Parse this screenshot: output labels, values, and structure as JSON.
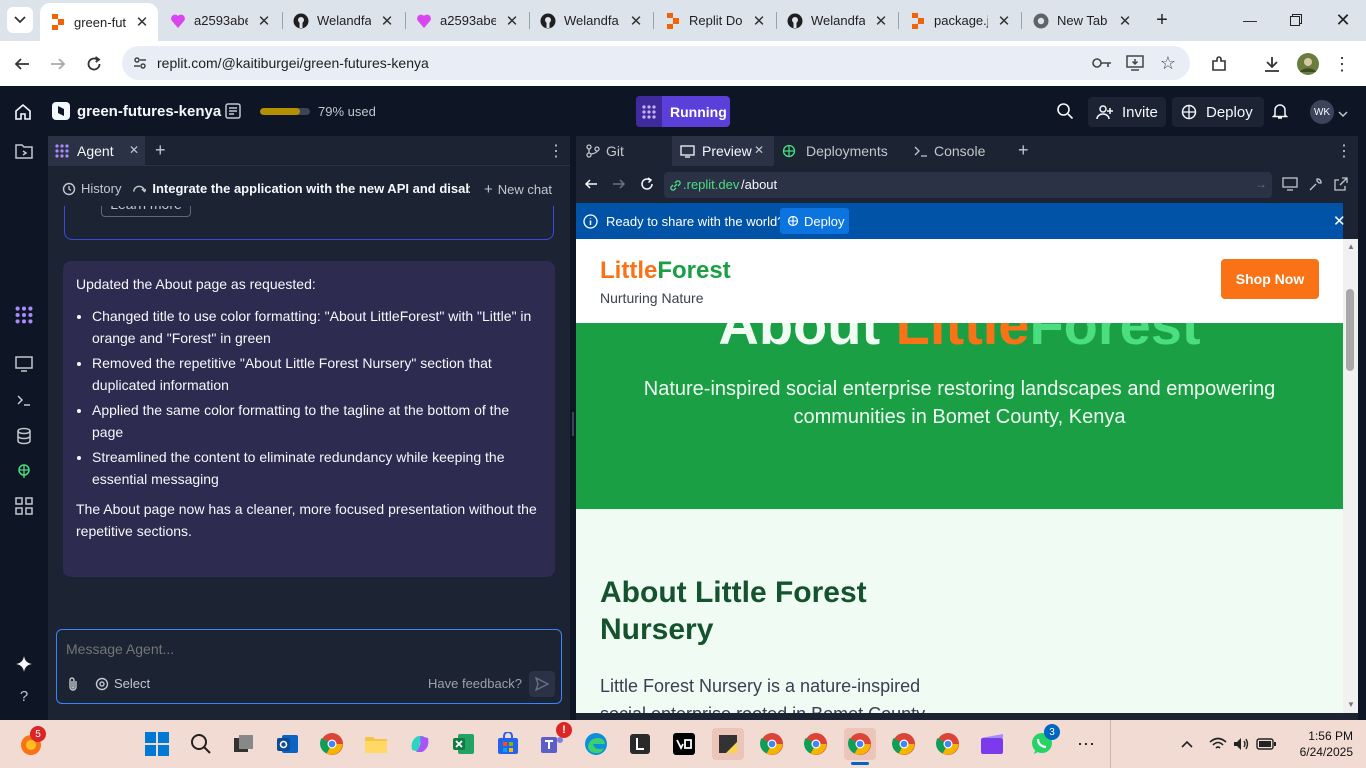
{
  "browser": {
    "tabs": [
      {
        "title": "green-futures-kenya",
        "favicon": "replit-icon",
        "active": true
      },
      {
        "title": "a2593abe",
        "favicon": "lovable-icon"
      },
      {
        "title": "Welandfa",
        "favicon": "github-icon"
      },
      {
        "title": "a2593abe",
        "favicon": "lovable-icon"
      },
      {
        "title": "Welandfa",
        "favicon": "github-icon"
      },
      {
        "title": "Replit Do",
        "favicon": "replit-icon"
      },
      {
        "title": "Welandfa",
        "favicon": "github-icon"
      },
      {
        "title": "package.js",
        "favicon": "replit-icon"
      },
      {
        "title": "New Tab",
        "favicon": "chrome-icon"
      }
    ],
    "url": "replit.com/@kaitiburgei/green-futures-kenya"
  },
  "header": {
    "project_name": "green-futures-kenya",
    "usage_text": "79% used",
    "usage_fraction": 0.79,
    "run_status": "Running",
    "invite_label": "Invite",
    "deploy_label": "Deploy",
    "avatar_initials": "WK"
  },
  "agent": {
    "tab_label": "Agent",
    "history_label": "History",
    "thread_title": "Integrate the application with the new API and disable S...",
    "new_chat_label": "New chat",
    "learn_more": "Learn more",
    "message": {
      "intro": "Updated the About page as requested:",
      "bullets": [
        "Changed title to use color formatting: \"About LittleForest\" with \"Little\" in orange and \"Forest\" in green",
        "Removed the repetitive \"About Little Forest Nursery\" section that duplicated information",
        "Applied the same color formatting to the tagline at the bottom of the page",
        "Streamlined the content to eliminate redundancy while keeping the essential messaging"
      ],
      "outro": "The About page now has a cleaner, more focused presentation without the repetitive sections."
    },
    "composer": {
      "placeholder": "Message Agent...",
      "select_label": "Select",
      "feedback_label": "Have feedback?"
    }
  },
  "right_tabs": [
    {
      "label": "Git"
    },
    {
      "label": "Preview",
      "active": true
    },
    {
      "label": "Deployments"
    },
    {
      "label": "Console"
    }
  ],
  "preview": {
    "url_domain": ".replit.dev",
    "url_path": "/about",
    "banner_text": "Ready to share with the world?",
    "banner_button": "Deploy"
  },
  "site": {
    "brand_little": "Little",
    "brand_forest": "Forest",
    "brand_tagline": "Nurturing Nature",
    "shop_button": "Shop Now",
    "hero_word_about": "About",
    "hero_word_little": "Little",
    "hero_word_forest": "Forest",
    "hero_subtitle": "Nature-inspired social enterprise restoring landscapes and empowering communities in Bomet County, Kenya",
    "section_title": "About Little Forest Nursery",
    "section_text": "Little Forest Nursery is a nature-inspired social enterprise rooted in Bomet County"
  },
  "taskbar": {
    "time": "1:56 PM",
    "date": "6/24/2025",
    "badges": {
      "left_widget": "5",
      "whatsapp": "3"
    }
  },
  "colors": {
    "replit_bg": "#0e1525",
    "pane_bg": "#1c2333",
    "agent_msg_bg": "#2d2b4f",
    "running_purple": "#5b3fd9",
    "orange": "#f97316",
    "forest_green": "#1a9f45",
    "light_green": "#4ade80",
    "dark_green": "#14532d",
    "banner_blue": "#0053a6"
  }
}
